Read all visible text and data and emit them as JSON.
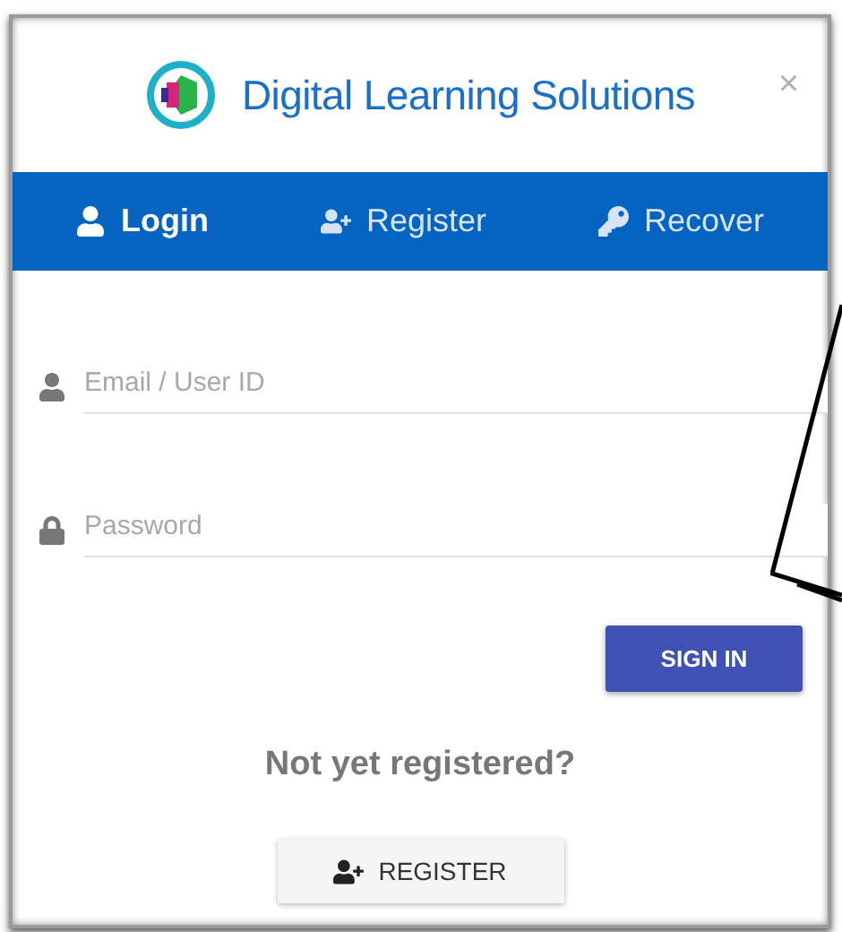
{
  "header": {
    "title": "Digital Learning Solutions",
    "close": "×"
  },
  "tabs": [
    {
      "label": "Login",
      "kind": "login",
      "selected": true
    },
    {
      "label": "Register",
      "kind": "register",
      "selected": false
    },
    {
      "label": "Recover",
      "kind": "recover",
      "selected": false
    }
  ],
  "fields": [
    {
      "placeholder": "Email / User ID",
      "kind": "email"
    },
    {
      "placeholder": "Password",
      "kind": "password"
    }
  ],
  "sign_in": "SIGN IN",
  "prompt": "Not yet registered?",
  "register": "REGISTER"
}
